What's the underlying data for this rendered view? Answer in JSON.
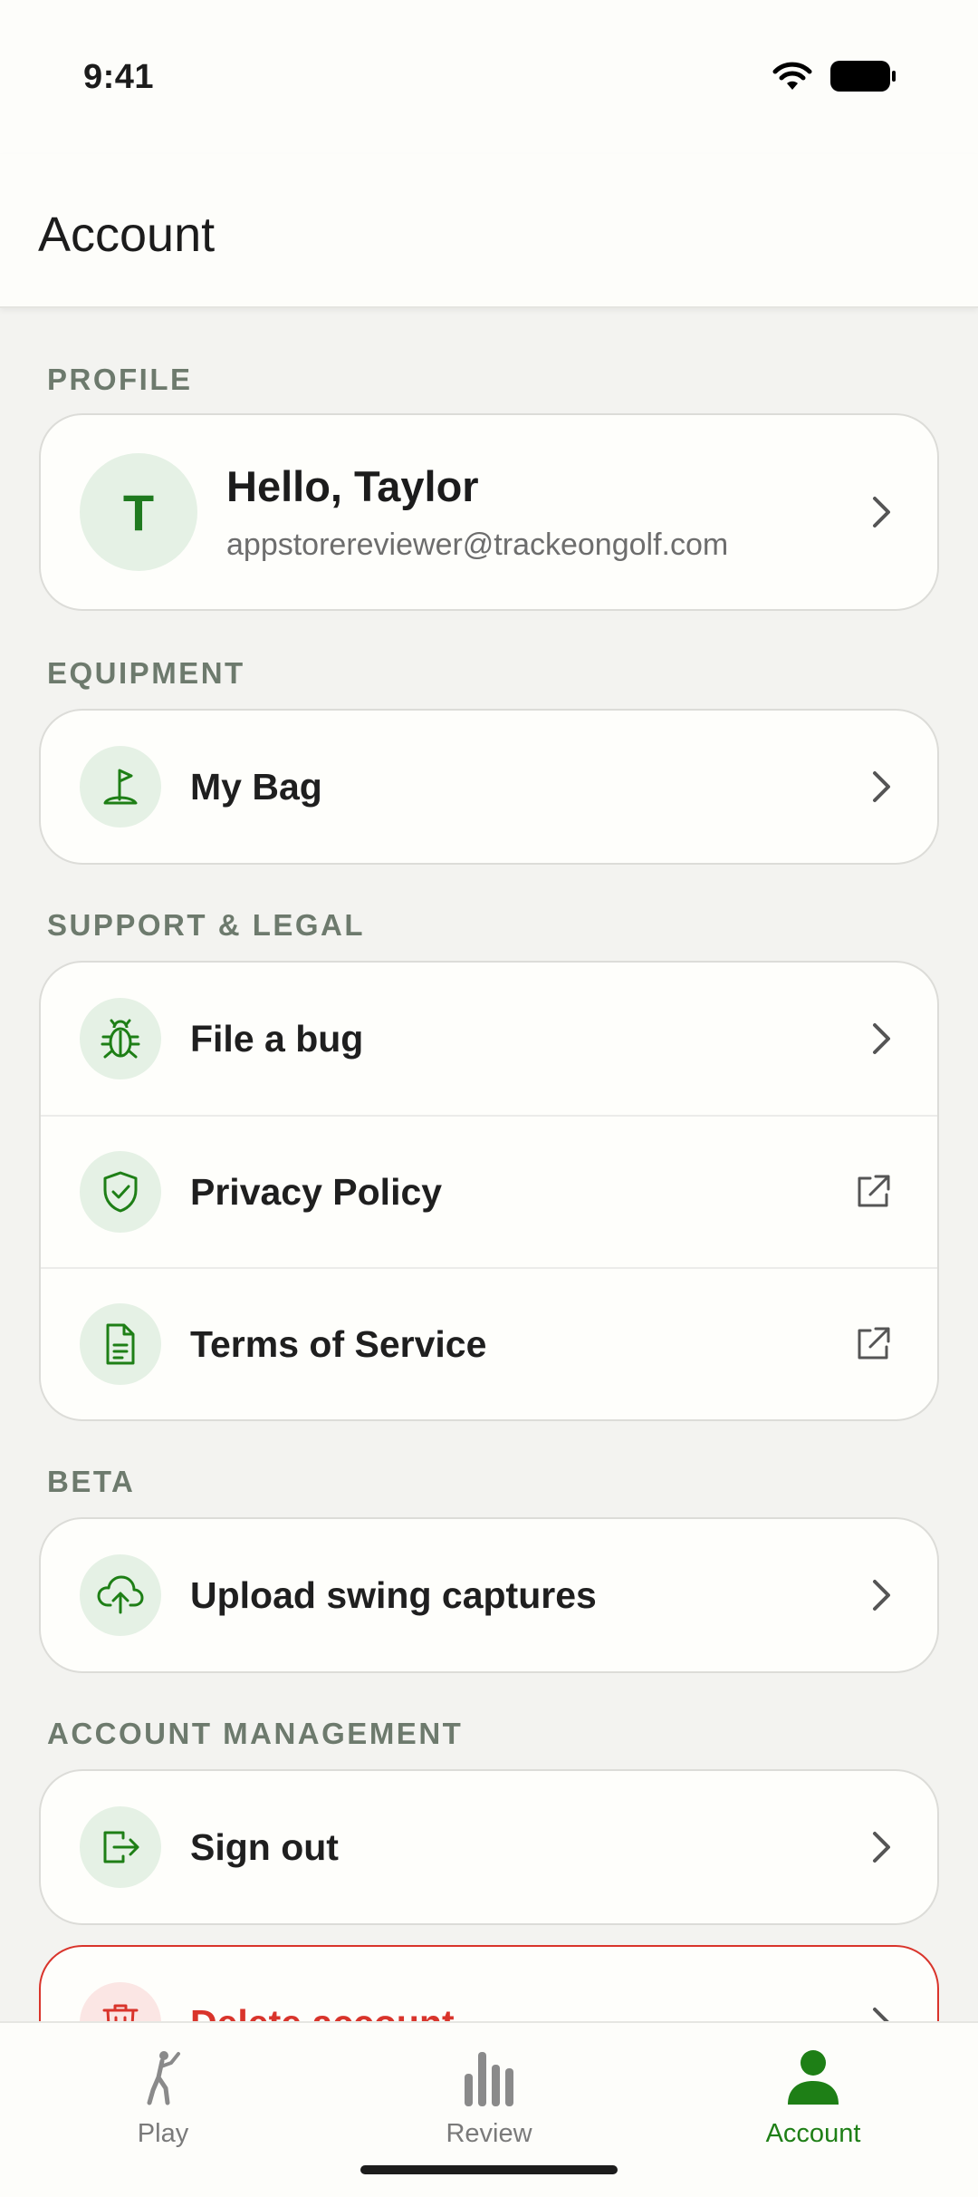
{
  "status_bar": {
    "time": "9:41"
  },
  "header": {
    "title": "Account"
  },
  "sections": {
    "profile": {
      "title": "PROFILE",
      "avatar_initial": "T",
      "greeting": "Hello, Taylor",
      "email": "appstorereviewer@trackeongolf.com"
    },
    "equipment": {
      "title": "EQUIPMENT",
      "my_bag": "My Bag"
    },
    "support": {
      "title": "SUPPORT & LEGAL",
      "file_bug": "File a bug",
      "privacy": "Privacy Policy",
      "terms": "Terms of Service"
    },
    "beta": {
      "title": "BETA",
      "upload": "Upload swing captures"
    },
    "account_management": {
      "title": "ACCOUNT MANAGEMENT",
      "sign_out": "Sign out",
      "delete": "Delete account"
    }
  },
  "tabbar": {
    "play": "Play",
    "review": "Review",
    "account": "Account",
    "active": "account"
  },
  "colors": {
    "accent": "#1e7f16",
    "danger": "#d9342b",
    "icon_bg": "#e5f1e5"
  }
}
